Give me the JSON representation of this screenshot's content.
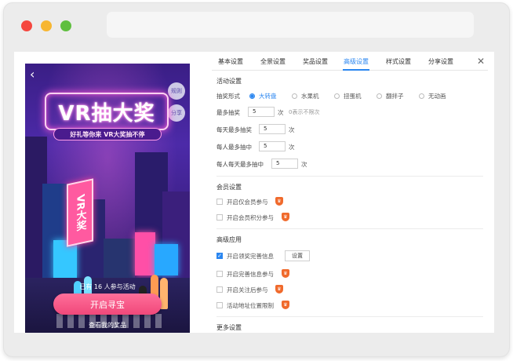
{
  "preview": {
    "back_icon": "‹",
    "rules_btn": "规则",
    "share_btn": "分享",
    "title": "VR抽大奖",
    "subtitle": "好礼等你来 VR大奖抽不停",
    "neon_sign": "VR大奖",
    "participants": "已有 16 人参与活动",
    "start_button": "开启寻宝",
    "my_prize": "查看我的奖品"
  },
  "tabs": [
    {
      "label": "基本设置"
    },
    {
      "label": "全景设置"
    },
    {
      "label": "奖品设置"
    },
    {
      "label": "高级设置",
      "active": true
    },
    {
      "label": "样式设置"
    },
    {
      "label": "分享设置"
    }
  ],
  "close_icon": "✕",
  "activity": {
    "section_title": "活动设置",
    "draw_type_label": "抽奖形式",
    "draw_types": [
      {
        "label": "大转盘",
        "checked": true
      },
      {
        "label": "水果机",
        "checked": false
      },
      {
        "label": "扭蛋机",
        "checked": false
      },
      {
        "label": "翻拌子",
        "checked": false
      },
      {
        "label": "无动画",
        "checked": false
      }
    ],
    "max_draws_label": "最多抽奖",
    "max_draws_value": "5",
    "max_draws_unit": "次",
    "max_draws_hint": "0表示不限次",
    "daily_max_label": "每天最多抽奖",
    "daily_max_value": "5",
    "daily_max_unit": "次",
    "per_person_win_label": "每人最多抽中",
    "per_person_win_value": "5",
    "per_person_win_unit": "次",
    "per_person_daily_win_label": "每人每天最多抽中",
    "per_person_daily_win_value": "5",
    "per_person_daily_win_unit": "次"
  },
  "member": {
    "section_title": "会员设置",
    "items": [
      {
        "label": "开启仅会员参与",
        "checked": false
      },
      {
        "label": "开启会员积分参与",
        "checked": false
      }
    ]
  },
  "advanced": {
    "section_title": "高级应用",
    "items": [
      {
        "label": "开启领奖完善信息",
        "checked": true,
        "button": "设置"
      },
      {
        "label": "开启完善信息参与",
        "checked": false
      },
      {
        "label": "开启关注后参与",
        "checked": false
      },
      {
        "label": "活动地址位置限制",
        "checked": false
      }
    ]
  },
  "more": {
    "section_title": "更多设置"
  },
  "crown_icon": "♛",
  "colors": {
    "accent": "#2a86f0",
    "crown": "#f06a2c",
    "start_button": "#f0487a"
  }
}
